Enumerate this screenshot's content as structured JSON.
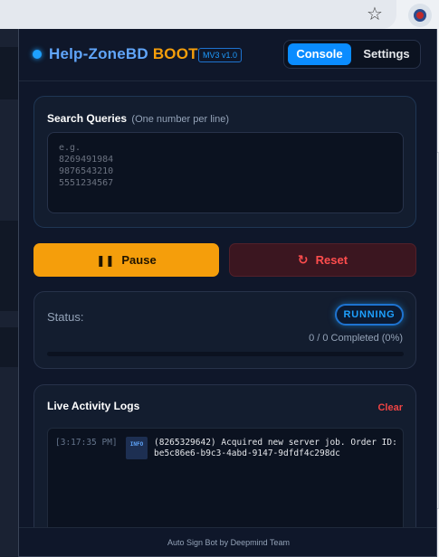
{
  "app": {
    "title_part1": "Help-ZoneBD",
    "title_part2": "BOOT",
    "version": "MV3 v1.0"
  },
  "tabs": [
    {
      "label": "Console",
      "active": true
    },
    {
      "label": "Settings",
      "active": false
    }
  ],
  "queries": {
    "label": "Search Queries",
    "hint": "(One number per line)",
    "placeholder": "e.g.\n8269491984\n9876543210\n5551234567"
  },
  "controls": {
    "pause_label": "Pause",
    "reset_label": "Reset"
  },
  "status": {
    "label": "Status:",
    "state": "RUNNING",
    "progress_text": "0 / 0 Completed (0%)",
    "progress_fraction": 0
  },
  "logs": {
    "title": "Live Activity Logs",
    "clear_label": "Clear",
    "entries": [
      {
        "time": "[3:17:35 PM]",
        "level": "INFO",
        "message": "(8265329642) Acquired new server job. Order ID: be5c86e6-b9c3-4abd-9147-9dfdf4c298dc"
      }
    ]
  },
  "footer": {
    "text": "Auto Sign Bot by Deepmind Team"
  },
  "colors": {
    "accent": "#0a8cff",
    "pause": "#f59e0b",
    "danger": "#ef4444",
    "panel": "#0f172a"
  },
  "icons": {
    "bookmark": "star-icon",
    "extension": "extension-icon",
    "pause": "pause-icon",
    "reset": "reset-icon"
  }
}
